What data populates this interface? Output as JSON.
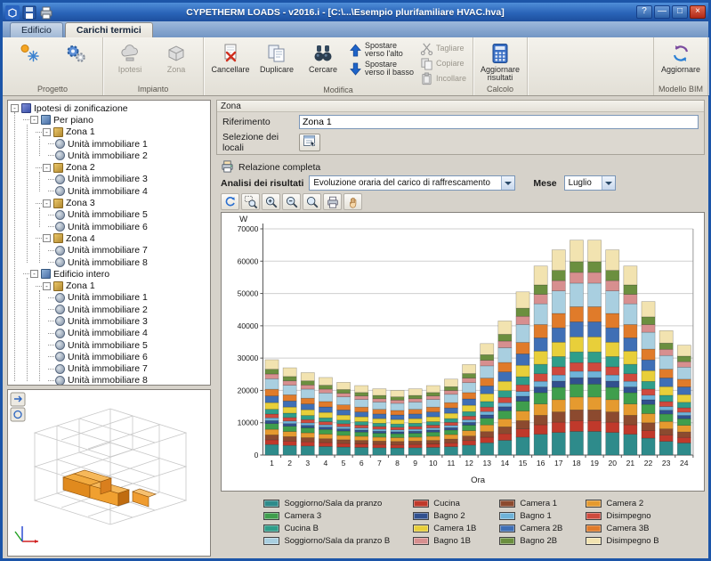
{
  "window": {
    "title": "CYPETHERM LOADS - v2016.i - [C:\\...\\Esempio plurifamiliare HVAC.hva]",
    "controls": {
      "help": "?",
      "minimize": "—",
      "maximize": "□",
      "close": "×"
    }
  },
  "tabs": {
    "edificio": "Edificio",
    "carichi_termici": "Carichi termici"
  },
  "ribbon": {
    "groups": {
      "progetto": {
        "label": "Progetto"
      },
      "impianto": {
        "label": "Impianto",
        "ipotesi": "Ipotesi",
        "zona": "Zona"
      },
      "modifica": {
        "label": "Modifica",
        "cancellare": "Cancellare",
        "duplicare": "Duplicare",
        "cercare": "Cercare",
        "sposta_su": "Spostare verso l'alto",
        "sposta_giu": "Spostare verso il basso",
        "tagliare": "Tagliare",
        "copiare": "Copiare",
        "incollare": "Incollare"
      },
      "calcolo": {
        "label": "Calcolo",
        "aggiornare_risultati": "Aggiornare risultati"
      },
      "bim": {
        "label": "Modello BIM",
        "aggiornare": "Aggiornare"
      }
    }
  },
  "zona_panel": {
    "header": "Zona",
    "riferimento_label": "Riferimento",
    "riferimento_value": "Zona 1",
    "selezione_label": "Selezione dei locali"
  },
  "results": {
    "relazione": "Relazione completa",
    "analisi_label": "Analisi dei risultati",
    "analisi_value": "Evoluzione oraria del carico di raffrescamento",
    "mese_label": "Mese",
    "mese_value": "Luglio"
  },
  "tree": {
    "collapse_glyph": "-",
    "root": "Ipotesi di zonificazione",
    "nodes": [
      {
        "label": "Per piano",
        "type": "group",
        "children": [
          {
            "label": "Zona 1",
            "type": "zone",
            "children": [
              {
                "label": "Unità immobiliare 1",
                "type": "unit"
              },
              {
                "label": "Unità immobiliare 2",
                "type": "unit"
              }
            ]
          },
          {
            "label": "Zona 2",
            "type": "zone",
            "children": [
              {
                "label": "Unità immobiliare 3",
                "type": "unit"
              },
              {
                "label": "Unità immobiliare 4",
                "type": "unit"
              }
            ]
          },
          {
            "label": "Zona 3",
            "type": "zone",
            "children": [
              {
                "label": "Unità immobiliare 5",
                "type": "unit"
              },
              {
                "label": "Unità immobiliare 6",
                "type": "unit"
              }
            ]
          },
          {
            "label": "Zona 4",
            "type": "zone",
            "children": [
              {
                "label": "Unità immobiliare 7",
                "type": "unit"
              },
              {
                "label": "Unità immobiliare 8",
                "type": "unit"
              }
            ]
          }
        ]
      },
      {
        "label": "Edificio intero",
        "type": "group",
        "children": [
          {
            "label": "Zona 1",
            "type": "zone",
            "children": [
              {
                "label": "Unità immobiliare 1",
                "type": "unit"
              },
              {
                "label": "Unità immobiliare 2",
                "type": "unit"
              },
              {
                "label": "Unità immobiliare 3",
                "type": "unit"
              },
              {
                "label": "Unità immobiliare 4",
                "type": "unit"
              },
              {
                "label": "Unità immobiliare 5",
                "type": "unit"
              },
              {
                "label": "Unità immobiliare 6",
                "type": "unit"
              },
              {
                "label": "Unità immobiliare 7",
                "type": "unit"
              },
              {
                "label": "Unità immobiliare 8",
                "type": "unit"
              }
            ]
          }
        ]
      }
    ]
  },
  "chart_data": {
    "type": "bar",
    "stacked": true,
    "title": "",
    "ylabel": "W",
    "xlabel": "Ora",
    "ylim": [
      0,
      70000
    ],
    "ytick_step": 10000,
    "grid": true,
    "legend_position": "bottom",
    "x": [
      1,
      2,
      3,
      4,
      5,
      6,
      7,
      8,
      9,
      10,
      11,
      12,
      13,
      14,
      15,
      16,
      17,
      18,
      19,
      20,
      21,
      22,
      23,
      24
    ],
    "totals": [
      29500,
      27000,
      25500,
      24000,
      22500,
      21500,
      20500,
      20000,
      20500,
      21500,
      23500,
      28000,
      34500,
      41500,
      50500,
      58500,
      63500,
      66500,
      66500,
      63500,
      58500,
      47500,
      38500,
      34000
    ],
    "series": [
      {
        "name": "Soggiorno/Sala da pranzo",
        "color": "#2e8b8b",
        "share": 0.11
      },
      {
        "name": "Cucina",
        "color": "#c0392b",
        "share": 0.05
      },
      {
        "name": "Camera 1",
        "color": "#8c4a2f",
        "share": 0.05
      },
      {
        "name": "Camera 2",
        "color": "#e59a2f",
        "share": 0.06
      },
      {
        "name": "Camera 3",
        "color": "#3f9e4d",
        "share": 0.06
      },
      {
        "name": "Bagno 2",
        "color": "#31508f",
        "share": 0.03
      },
      {
        "name": "Bagno 1",
        "color": "#6fb3d9",
        "share": 0.03
      },
      {
        "name": "Disimpegno",
        "color": "#cf4a3e",
        "share": 0.04
      },
      {
        "name": "Cucina B",
        "color": "#2f9e8a",
        "share": 0.05
      },
      {
        "name": "Camera 1B",
        "color": "#e8cf3a",
        "share": 0.07
      },
      {
        "name": "Camera 2B",
        "color": "#3f6fb5",
        "share": 0.07
      },
      {
        "name": "Camera 3B",
        "color": "#e07b2a",
        "share": 0.07
      },
      {
        "name": "Soggiorno/Sala da pranzo B",
        "color": "#a9cfe0",
        "share": 0.11
      },
      {
        "name": "Bagno 1B",
        "color": "#d78f8f",
        "share": 0.05
      },
      {
        "name": "Bagno 2B",
        "color": "#6b8f3f",
        "share": 0.05
      },
      {
        "name": "Disimpegno B",
        "color": "#f2e3b0",
        "share": 0.1
      }
    ]
  }
}
